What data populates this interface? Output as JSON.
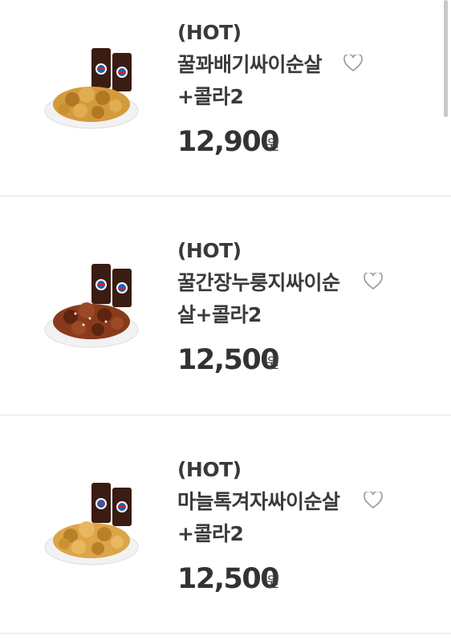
{
  "items": [
    {
      "tag": "(HOT)",
      "name_line1": "꿀꽈배기싸이순살",
      "name_line2": "+콜라2",
      "price": "12,900",
      "currency": "원",
      "chicken_color": "#d49a3c",
      "chicken_dark": "#b07822"
    },
    {
      "tag": "(HOT)",
      "name_line1": "꿀간장누룽지싸이순",
      "name_line2": "살+콜라2",
      "price": "12,500",
      "currency": "원",
      "chicken_color": "#8a3a1c",
      "chicken_dark": "#5e2410"
    },
    {
      "tag": "(HOT)",
      "name_line1": "마늘톡겨자싸이순살",
      "name_line2": "+콜라2",
      "price": "12,500",
      "currency": "원",
      "chicken_color": "#dda448",
      "chicken_dark": "#b8802a"
    }
  ],
  "colors": {
    "text": "#3a3a3a",
    "heart_outline": "#999999",
    "divider": "#e4e4e4"
  },
  "icons": {
    "favorite": "heart-outline-icon"
  }
}
